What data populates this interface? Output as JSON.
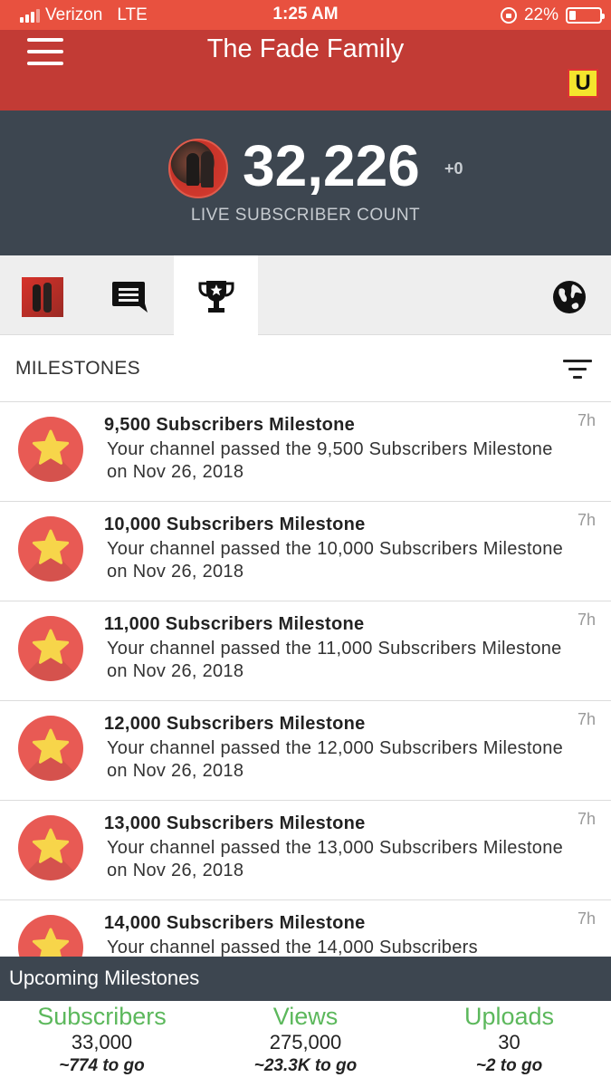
{
  "status_bar": {
    "carrier": "Verizon",
    "network": "LTE",
    "time": "1:25 AM",
    "battery": "22%",
    "battery_level": 0.22
  },
  "header": {
    "title": "The Fade Family",
    "badge": "U",
    "badge_color": "#f4e52d"
  },
  "counter": {
    "value": "32,226",
    "delta": "+0",
    "caption": "LIVE SUBSCRIBER COUNT"
  },
  "tabs": [
    {
      "icon": "channel-avatar",
      "active": false
    },
    {
      "icon": "chat-icon",
      "active": false
    },
    {
      "icon": "trophy-icon",
      "active": true
    },
    {
      "icon": "globe-icon",
      "active": false
    }
  ],
  "milestones": {
    "title": "MILESTONES",
    "items": [
      {
        "title": "9,500 Subscribers Milestone",
        "desc": "Your channel passed the 9,500 Subscribers Milestone on Nov 26, 2018",
        "time": "7h"
      },
      {
        "title": "10,000 Subscribers Milestone",
        "desc": "Your channel passed the 10,000 Subscribers Milestone on Nov 26, 2018",
        "time": "7h"
      },
      {
        "title": "11,000 Subscribers Milestone",
        "desc": "Your channel passed the 11,000 Subscribers Milestone on Nov 26, 2018",
        "time": "7h"
      },
      {
        "title": "12,000 Subscribers Milestone",
        "desc": "Your channel passed the 12,000 Subscribers Milestone on Nov 26, 2018",
        "time": "7h"
      },
      {
        "title": "13,000 Subscribers Milestone",
        "desc": "Your channel passed the 13,000 Subscribers Milestone on Nov 26, 2018",
        "time": "7h"
      },
      {
        "title": "14,000 Subscribers Milestone",
        "desc": "Your channel passed the 14,000 Subscribers",
        "time": "7h"
      }
    ]
  },
  "upcoming": {
    "title": "Upcoming Milestones",
    "stats": [
      {
        "label": "Subscribers",
        "value": "33,000",
        "togo": "~774 to go"
      },
      {
        "label": "Views",
        "value": "275,000",
        "togo": "~23.3K to go"
      },
      {
        "label": "Uploads",
        "value": "30",
        "togo": "~2 to go"
      }
    ]
  },
  "colors": {
    "status_bar": "#e8513f",
    "header": "#c23b35",
    "dark_band": "#3d4650",
    "accent_green": "#5cb85c",
    "star_bg": "#e85a54",
    "star": "#f7d54a"
  }
}
